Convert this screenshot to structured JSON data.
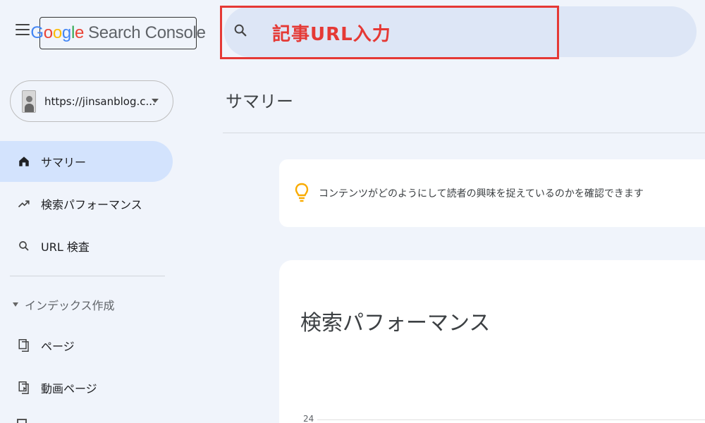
{
  "header": {
    "logo_google_letters": [
      "G",
      "o",
      "o",
      "g",
      "l",
      "e"
    ],
    "logo_product": "Search Console",
    "search_overlay_text": "記事URL入力"
  },
  "colors": {
    "google_blue": "#4285F4",
    "google_red": "#EA4335",
    "google_yellow": "#FBBC05",
    "google_green": "#34A853",
    "annotation_red": "#E53935",
    "active_nav_bg": "#D3E3FD",
    "search_bg": "#DDE6F6"
  },
  "sidebar": {
    "property_url": "https://jinsanblog.c...",
    "items": [
      {
        "label": "サマリー",
        "icon": "home-icon",
        "active": true
      },
      {
        "label": "検索パフォーマンス",
        "icon": "trending-up-icon",
        "active": false
      },
      {
        "label": "URL 検査",
        "icon": "search-icon",
        "active": false
      }
    ],
    "section_index": {
      "label": "インデックス作成",
      "items": [
        {
          "label": "ページ",
          "icon": "pages-icon"
        },
        {
          "label": "動画ページ",
          "icon": "video-page-icon"
        }
      ]
    }
  },
  "main": {
    "page_title": "サマリー",
    "insight_text": "コンテンツがどのようにして読者の興味を捉えているのかを確認できます",
    "performance": {
      "title": "検索パフォーマンス",
      "y_tick_top": "24"
    }
  }
}
